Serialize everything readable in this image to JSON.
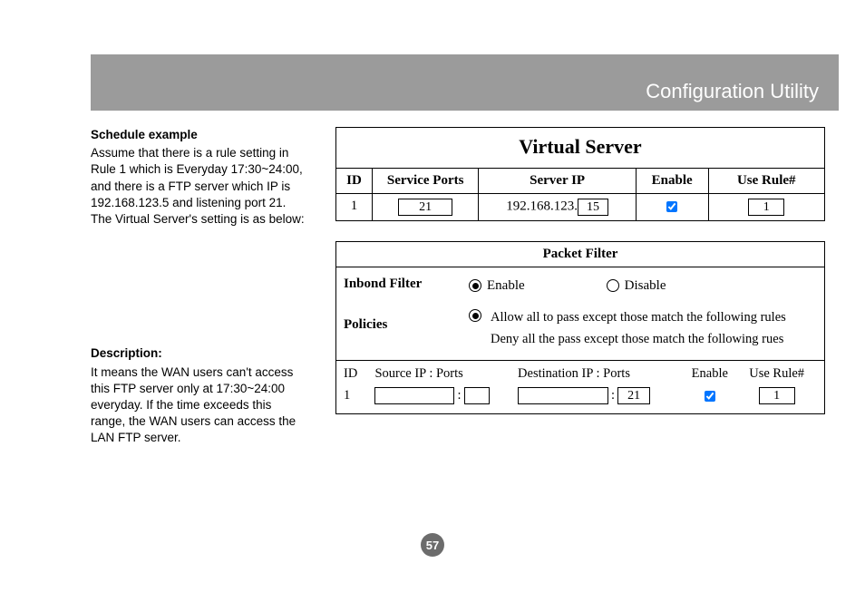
{
  "banner_title": "Configuration Utility",
  "schedule": {
    "heading": "Schedule example",
    "body": "Assume that there is a rule setting in Rule 1 which is Everyday 17:30~24:00, and there is a FTP server which IP is 192.168.123.5 and listening port 21. The Virtual Server's setting is as below:"
  },
  "description": {
    "heading": "Description:",
    "body": "It means the WAN users can't access this FTP server only at 17:30~24:00 everyday. If the time exceeds this range, the WAN users can access the LAN FTP server."
  },
  "virtual_server": {
    "title": "Virtual Server",
    "headers": {
      "id": "ID",
      "service_ports": "Service Ports",
      "server_ip": "Server IP",
      "enable": "Enable",
      "use_rule": "Use Rule#"
    },
    "row": {
      "id": "1",
      "service_port": "21",
      "server_ip_prefix": "192.168.123.",
      "server_ip_last": "15",
      "enable_checked": true,
      "use_rule": "1"
    }
  },
  "packet_filter": {
    "title": "Packet Filter",
    "inbound_label": "Inbond Filter",
    "enable_label": "Enable",
    "disable_label": "Disable",
    "inbound_selected": "enable",
    "policies_label": "Policies",
    "policy_allow": "Allow all to pass except those match the following rules",
    "policy_deny": "Deny all the pass except those match the following rues",
    "policy_selected": "allow",
    "table_headers": {
      "id": "ID",
      "src": "Source IP : Ports",
      "dst": "Destination IP : Ports",
      "enable": "Enable",
      "use_rule": "Use Rule#"
    },
    "row": {
      "id": "1",
      "src_ip": "",
      "src_port": "",
      "dst_ip": "",
      "dst_port": "21",
      "enable_checked": true,
      "use_rule": "1"
    }
  },
  "page_number": "57"
}
